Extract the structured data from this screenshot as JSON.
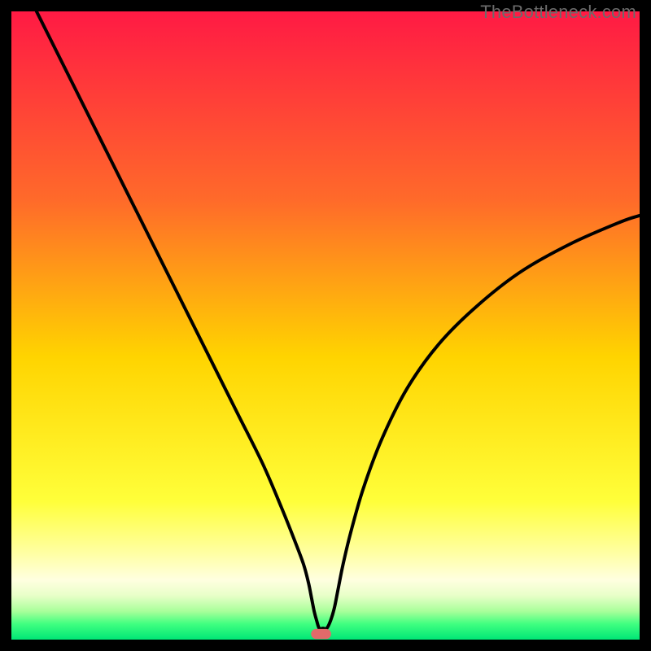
{
  "watermark": "TheBottleneck.com",
  "chart_data": {
    "type": "line",
    "title": "",
    "xlabel": "",
    "ylabel": "",
    "xlim": [
      0,
      100
    ],
    "ylim": [
      0,
      100
    ],
    "gradient_stops": [
      {
        "offset": 0.0,
        "color": "#ff1a44"
      },
      {
        "offset": 0.3,
        "color": "#ff6a2a"
      },
      {
        "offset": 0.55,
        "color": "#ffd400"
      },
      {
        "offset": 0.78,
        "color": "#ffff3a"
      },
      {
        "offset": 0.86,
        "color": "#ffffa0"
      },
      {
        "offset": 0.905,
        "color": "#ffffe0"
      },
      {
        "offset": 0.93,
        "color": "#e8ffc8"
      },
      {
        "offset": 0.955,
        "color": "#a8ff9a"
      },
      {
        "offset": 0.975,
        "color": "#40ff80"
      },
      {
        "offset": 1.0,
        "color": "#00e676"
      }
    ],
    "series": [
      {
        "name": "bottleneck-curve",
        "x": [
          4,
          8,
          12,
          16,
          20,
          24,
          28,
          32,
          36,
          40,
          43,
          45,
          46.5,
          47.3,
          47.8,
          48.2,
          48.6,
          49.0,
          49.6,
          50.2,
          50.8,
          51.4,
          52.0,
          52.8,
          54.0,
          56.0,
          59.0,
          63.0,
          68.0,
          74.0,
          81.0,
          89.0,
          97.0,
          100.0
        ],
        "y": [
          100,
          92,
          84,
          76,
          68,
          60,
          52,
          44,
          36,
          28,
          21,
          16,
          12,
          9,
          6.5,
          4.5,
          3.0,
          1.8,
          1.8,
          1.8,
          3.0,
          5.0,
          8.0,
          12.0,
          17.0,
          24.0,
          32.0,
          40.0,
          47.0,
          53.0,
          58.5,
          63.0,
          66.5,
          67.5
        ]
      }
    ],
    "marker": {
      "name": "optimal-range",
      "shape": "pill",
      "color": "#e26a6a",
      "x_center": 49.3,
      "y_center": 0.9,
      "width": 3.2,
      "height": 1.6
    }
  }
}
